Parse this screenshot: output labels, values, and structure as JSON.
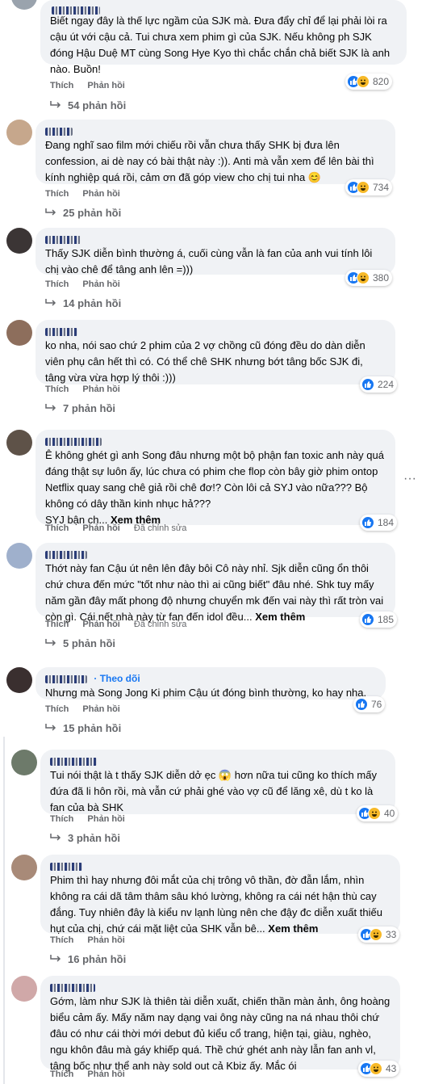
{
  "ui": {
    "like_label": "Thích",
    "reply_label": "Phản hồi",
    "edited_label": "Đã chỉnh sửa",
    "see_more": "Xem thêm",
    "follow_label": "Theo dõi"
  },
  "comments": [
    {
      "text": "Biết ngay đây là thế lực ngầm của SJK mà. Đưa đẩy chỉ để lại phải lòi ra cậu út với cậu cả. Tui chưa xem phim gì của SJK. Nếu không ph SJK đóng Hậu Duệ MT cùng Song Hye Kyo thì chắc chắn chả biết SJK là anh nào. Buồn!",
      "reactions": "820",
      "replies": "54 phản hồi"
    },
    {
      "text": "Đang nghĩ sao film mới chiếu rồi vẫn chưa thấy SHK bị đưa lên confession, ai dè nay có bài thật này :)). Anti mà vẫn xem để lên bài thì kính nghiệp quá rồi, cảm ơn đã góp view cho chị tui nha 😊",
      "reactions": "734",
      "replies": "25 phản hồi"
    },
    {
      "text": "Thấy SJK diễn bình thường á, cuối cùng vẫn là fan của anh vui tính lôi chị vào chê để tâng anh lên =)))",
      "reactions": "380",
      "replies": "14 phản hồi"
    },
    {
      "text": "ko nha, nói sao chứ 2 phim của 2 vợ chồng cũ đóng đều do dàn diễn viên phụ cân hết thì có. Có thể chê SHK nhưng bớt tâng bốc SJK đi, tâng vừa vừa hợp lý thôi :)))",
      "reactions": "224",
      "replies": "7 phản hồi"
    },
    {
      "text": "Ê không ghét gì anh Song đâu nhưng một bộ phận fan toxic anh này quá đáng thật sự luôn ấy, lúc chưa có phim che flop còn bây giờ phim ontop Netflix quay sang chê giả rồi chê đơ!? Còn lôi cả SYJ vào nữa??? Bộ không có dây thần kinh nhục hả???",
      "text2": "SYJ bận ch...",
      "reactions": "184"
    },
    {
      "text": "Thớt này fan Cậu út nên lên đây bôi Cô này nhỉ. Sjk diễn cũng ổn thôi chứ chưa đến mức \"tốt như nào thì ai cũng biết\" đâu nhé. Shk tuy mấy năm gần đây mất phong độ nhưng chuyển mk đến vai này thì rất tròn vai còn gì. Cái nết nhà này từ fan đến idol đều...",
      "reactions": "185",
      "replies": "5 phản hồi"
    },
    {
      "text": "Nhưng mà Song Jong Ki phim Cậu út đóng bình thường, ko hay nha.",
      "reactions": "76",
      "replies": "15 phản hồi"
    },
    {
      "text": "Tui nói thật là t thấy SJK diễn dở ẹc 😱 hơn nữa tui cũng ko thích mấy đứa đã li hôn rồi, mà vẫn cứ phải ghé vào vợ cũ để lăng xê, dù t ko là fan của bà SHK",
      "reactions": "40",
      "replies": "3 phản hồi"
    },
    {
      "text": "Phim thì hay nhưng đôi mắt của chị trông vô thần, đờ đẫn lắm, nhìn không ra cái dã tâm thâm sâu khó lường, không ra cái nét hận thù cay đắng. Tuy nhiên đây là kiểu nv lạnh lùng nên che đậy đc diễn xuất thiếu hụt của chị, chứ cái mặt liệt của SHK vẫn bê...",
      "reactions": "33",
      "replies": "16 phản hồi"
    },
    {
      "text": "Gớm, làm như SJK là thiên tài diễn xuất, chiến thần màn ảnh, ông hoàng biểu cảm ấy. Mấy năm nay dạng vai ông này cũng na ná nhau thôi chứ đâu có như cái thời mới debut đủ kiểu cổ trang, hiện tại, giàu, nghèo, ngu khôn đâu mà gáy khiếp quá. Thề chứ ghét anh này lẫn fan anh vl, tâng bốc như thể anh này sold out cả Kbiz ấy. Mắc ói",
      "reactions": "43"
    }
  ]
}
